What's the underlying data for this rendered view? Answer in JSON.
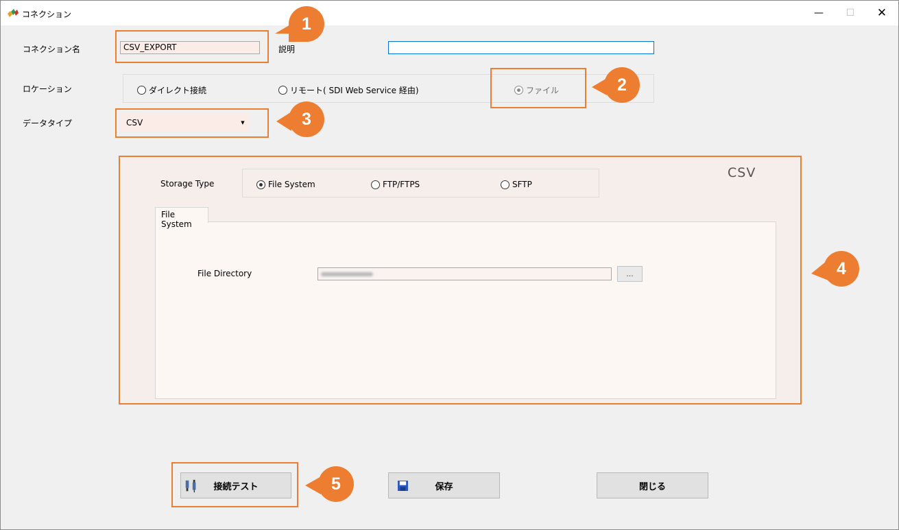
{
  "window": {
    "title": "コネクション",
    "minimize_glyph": "—",
    "maximize_glyph": "☐",
    "close_glyph": "✕"
  },
  "form": {
    "connection_name_label": "コネクション名",
    "connection_name_value": "CSV_EXPORT",
    "description_label": "説明",
    "description_value": "",
    "location_label": "ロケーション",
    "location_options": [
      {
        "label": "ダイレクト接続",
        "selected": false
      },
      {
        "label": "リモート( SDI Web Service 経由)",
        "selected": false
      },
      {
        "label": "ファイル",
        "selected": true
      }
    ],
    "data_type_label": "データタイプ",
    "data_type_value": "CSV"
  },
  "csv_panel": {
    "header": "CSV",
    "storage_type_label": "Storage Type",
    "storage_options": [
      {
        "label": "File System",
        "selected": true
      },
      {
        "label": "FTP/FTPS",
        "selected": false
      },
      {
        "label": "SFTP",
        "selected": false
      }
    ],
    "tab_label": "File System",
    "file_directory_label": "File Directory",
    "file_directory_value": "",
    "browse_label": "..."
  },
  "buttons": {
    "test_connection": "接続テスト",
    "save": "保存",
    "close": "閉じる"
  },
  "callouts": [
    "1",
    "2",
    "3",
    "4",
    "5"
  ],
  "colors": {
    "accent": "#ed7d31",
    "panel_bg": "#f6eeea",
    "input_bg": "#fbece8"
  },
  "icons": {
    "app": "app-logo-icon",
    "test": "usb-plug-icon",
    "save": "floppy-disk-icon",
    "combo": "dropdown-arrow-icon"
  }
}
